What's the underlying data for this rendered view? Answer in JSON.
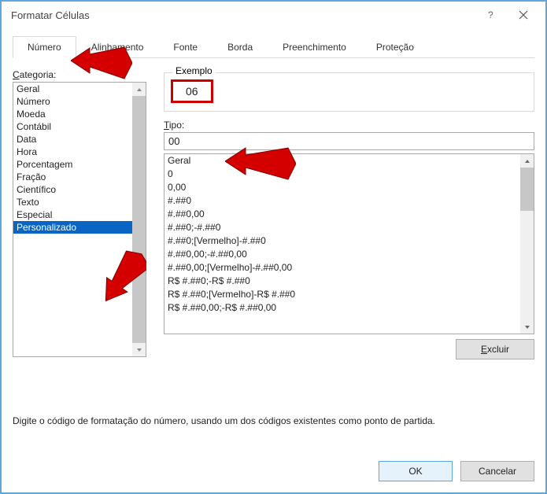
{
  "window": {
    "title": "Formatar Células"
  },
  "tabs": {
    "numero": "Número",
    "alinhamento": "Alinhamento",
    "fonte": "Fonte",
    "borda": "Borda",
    "preenchimento": "Preenchimento",
    "protecao": "Proteção"
  },
  "labels": {
    "categoria": "Categoria:",
    "exemplo": "Exemplo",
    "tipo": "Tipo:",
    "excluir": "Excluir",
    "hint": "Digite o código de formatação do número, usando um dos códigos existentes como ponto de partida.",
    "ok": "OK",
    "cancelar": "Cancelar"
  },
  "example_value": "06",
  "type_value": "00",
  "categories": [
    "Geral",
    "Número",
    "Moeda",
    "Contábil",
    "Data",
    "Hora",
    "Porcentagem",
    "Fração",
    "Científico",
    "Texto",
    "Especial",
    "Personalizado"
  ],
  "selected_category_index": 11,
  "formats": [
    "Geral",
    "0",
    "0,00",
    "#.##0",
    "#.##0,00",
    "#.##0;-#.##0",
    "#.##0;[Vermelho]-#.##0",
    "#.##0,00;-#.##0,00",
    "#.##0,00;[Vermelho]-#.##0,00",
    "R$ #.##0;-R$ #.##0",
    "R$ #.##0;[Vermelho]-R$ #.##0",
    "R$ #.##0,00;-R$ #.##0,00"
  ]
}
